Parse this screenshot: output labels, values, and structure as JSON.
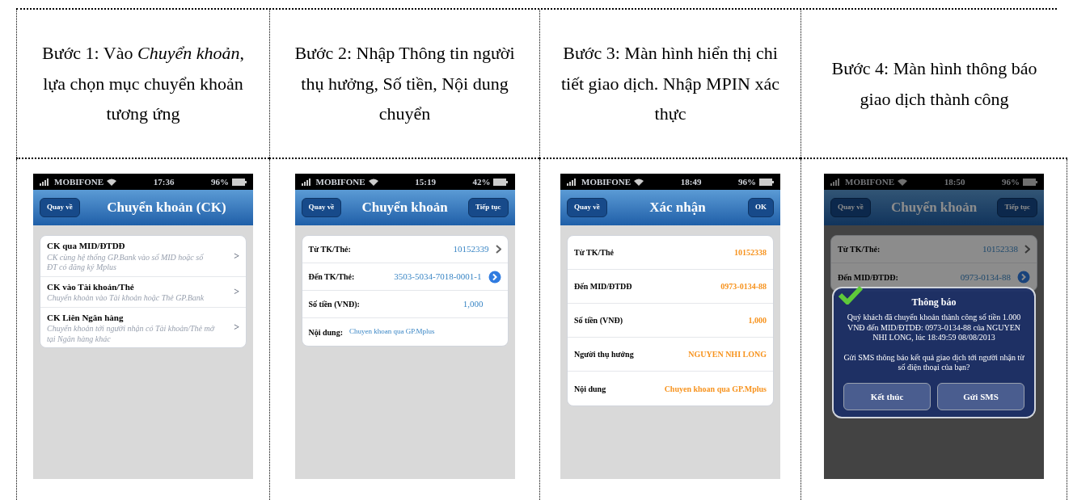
{
  "steps": [
    {
      "caption": "Bước 1: Vào *Chuyển khoản*, lựa chọn mục chuyển khoản tương ứng",
      "phone": {
        "carrier": "MOBIFONE",
        "time": "17:36",
        "battery": "96%",
        "back": "Quay về",
        "title": "Chuyển khoản (CK)",
        "kind": "menu",
        "dimmed": false,
        "items": [
          {
            "title": "CK qua MID/ĐTDĐ",
            "subtitle": "CK cùng hệ thống GP.Bank vào số MID hoặc số ĐT có đăng ký Mplus",
            "chevron": ">"
          },
          {
            "title": "CK vào Tài khoản/Thẻ",
            "subtitle": "Chuyển khoản vào Tài khoản hoặc Thẻ GP.Bank",
            "chevron": ">"
          },
          {
            "title": "CK Liên Ngân hàng",
            "subtitle": "Chuyển khoản tới người nhận có Tài khoản/Thẻ mở tại Ngân hàng khác",
            "chevron": ">"
          }
        ]
      }
    },
    {
      "caption": "Bước 2: Nhập Thông tin người thụ hưởng, Số tiền, Nội dung chuyển",
      "phone": {
        "carrier": "MOBIFONE",
        "time": "15:19",
        "battery": "42%",
        "back": "Quay về",
        "title": "Chuyển khoản",
        "action": "Tiếp tục",
        "kind": "form",
        "dimmed": false,
        "rows": [
          {
            "label": "Từ TK/Thẻ:",
            "value": "10152339",
            "kind": "chevron"
          },
          {
            "label": "Đến TK/Thẻ:",
            "value": "3503-5034-7018-0001-1",
            "kind": "disclosure"
          },
          {
            "label": "Số tiền (VNĐ):",
            "value": "1,000",
            "kind": "plain"
          },
          {
            "label": "Nội dung:",
            "value": "Chuyen khoan qua GP.Mplus",
            "kind": "inline"
          }
        ]
      }
    },
    {
      "caption": "Bước 3: Màn hình hiển thị chi tiết giao dịch. Nhập MPIN xác thực",
      "phone": {
        "carrier": "MOBIFONE",
        "time": "18:49",
        "battery": "96%",
        "back": "Quay về",
        "title": "Xác nhận",
        "action": "OK",
        "kind": "confirm",
        "dimmed": false,
        "rows": [
          {
            "label": "Từ TK/Thẻ",
            "value": "10152338"
          },
          {
            "label": "Đến MID/ĐTDĐ",
            "value": "0973-0134-88"
          },
          {
            "label": "Số tiền (VNĐ)",
            "value": "1,000"
          },
          {
            "label": "Người thụ hưởng",
            "value": "NGUYEN NHI LONG"
          },
          {
            "label": "Nội dung",
            "value": "Chuyen khoan qua GP.Mplus"
          }
        ]
      }
    },
    {
      "caption": "Bước 4: Màn hình thông báo giao dịch thành công",
      "phone": {
        "carrier": "MOBIFONE",
        "time": "18:50",
        "battery": "96%",
        "back": "Quay về",
        "title": "Chuyển khoản",
        "action": "Tiếp tục",
        "kind": "form",
        "dimmed": true,
        "rows": [
          {
            "label": "Từ TK/Thẻ:",
            "value": "10152338",
            "kind": "chevron"
          },
          {
            "label": "Đến MID/ĐTDĐ:",
            "value": "0973-0134-88",
            "kind": "disclosure"
          }
        ],
        "alert": {
          "title": "Thông báo",
          "message": "Quý khách đã chuyển khoản thành công số tiền 1.000 VNĐ đến MID/ĐTDĐ: 0973-0134-88 của NGUYEN NHI LONG, lúc 18:49:59 08/08/2013",
          "question": "Gửi SMS thông báo kết quả giao dịch tới người nhận từ số điện thoại của bạn?",
          "buttons": [
            "Kết thúc",
            "Gửi SMS"
          ]
        }
      }
    }
  ]
}
